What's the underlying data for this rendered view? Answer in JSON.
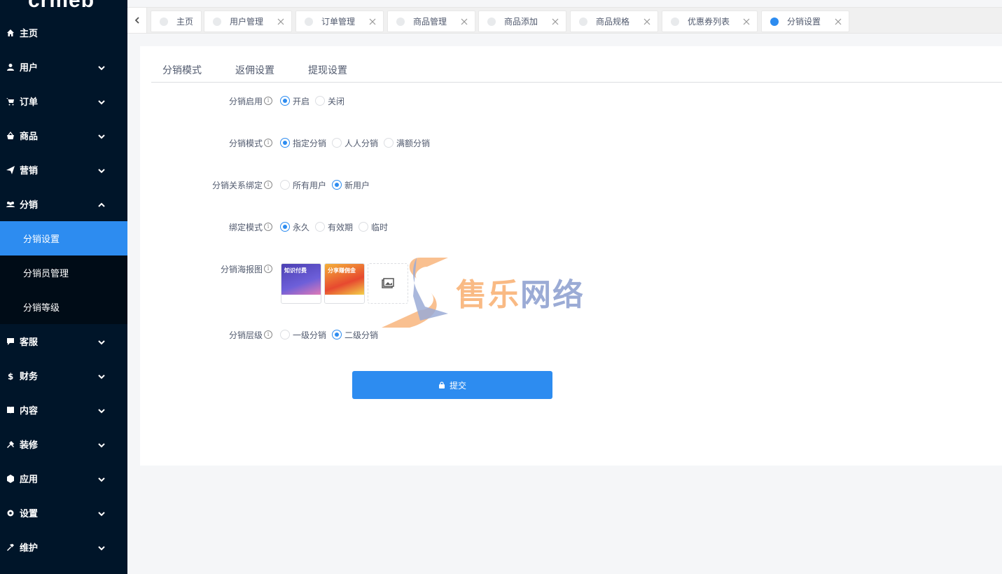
{
  "sidebar": {
    "logo": "crmeb",
    "items": [
      {
        "label": "主页",
        "icon": "home-icon",
        "expandable": false
      },
      {
        "label": "用户",
        "icon": "user-icon",
        "expandable": true
      },
      {
        "label": "订单",
        "icon": "cart-icon",
        "expandable": true
      },
      {
        "label": "商品",
        "icon": "basket-icon",
        "expandable": true
      },
      {
        "label": "营销",
        "icon": "send-icon",
        "expandable": true
      },
      {
        "label": "分销",
        "icon": "group-icon",
        "expandable": true,
        "open": true
      },
      {
        "label": "客服",
        "icon": "chat-icon",
        "expandable": true
      },
      {
        "label": "财务",
        "icon": "dollar-icon",
        "expandable": true
      },
      {
        "label": "内容",
        "icon": "book-icon",
        "expandable": true
      },
      {
        "label": "装修",
        "icon": "tools-icon",
        "expandable": true
      },
      {
        "label": "应用",
        "icon": "cube-icon",
        "expandable": true
      },
      {
        "label": "设置",
        "icon": "gear-icon",
        "expandable": true
      },
      {
        "label": "维护",
        "icon": "hammer-icon",
        "expandable": true
      }
    ],
    "submenu": [
      {
        "label": "分销设置",
        "active": true
      },
      {
        "label": "分销员管理",
        "active": false
      },
      {
        "label": "分销等级",
        "active": false
      }
    ]
  },
  "tabs": [
    {
      "label": "主页",
      "closable": false,
      "active": false
    },
    {
      "label": "用户管理",
      "closable": true,
      "active": false
    },
    {
      "label": "订单管理",
      "closable": true,
      "active": false
    },
    {
      "label": "商品管理",
      "closable": true,
      "active": false
    },
    {
      "label": "商品添加",
      "closable": true,
      "active": false
    },
    {
      "label": "商品规格",
      "closable": true,
      "active": false
    },
    {
      "label": "优惠券列表",
      "closable": true,
      "active": false
    },
    {
      "label": "分销设置",
      "closable": true,
      "active": true
    }
  ],
  "subtabs": [
    {
      "label": "分销模式",
      "active": true
    },
    {
      "label": "返佣设置",
      "active": false
    },
    {
      "label": "提现设置",
      "active": false
    }
  ],
  "form": {
    "enable": {
      "label": "分销启用",
      "options": [
        "开启",
        "关闭"
      ],
      "selected": 0
    },
    "mode": {
      "label": "分销模式",
      "options": [
        "指定分销",
        "人人分销",
        "满额分销"
      ],
      "selected": 0
    },
    "binding": {
      "label": "分销关系绑定",
      "options": [
        "所有用户",
        "新用户"
      ],
      "selected": 1
    },
    "bind_mode": {
      "label": "绑定模式",
      "options": [
        "永久",
        "有效期",
        "临时"
      ],
      "selected": 0
    },
    "poster": {
      "label": "分销海报图",
      "images": [
        "知识付费",
        "分享赚佣金"
      ]
    },
    "level": {
      "label": "分销层级",
      "options": [
        "一级分销",
        "二级分销"
      ],
      "selected": 1
    },
    "submit_label": "提交"
  },
  "watermark": {
    "text_a": "售乐",
    "text_b": "网络"
  },
  "colors": {
    "accent": "#2d8cf0",
    "sidebar_bg": "#001529",
    "submenu_bg": "#000c17"
  }
}
